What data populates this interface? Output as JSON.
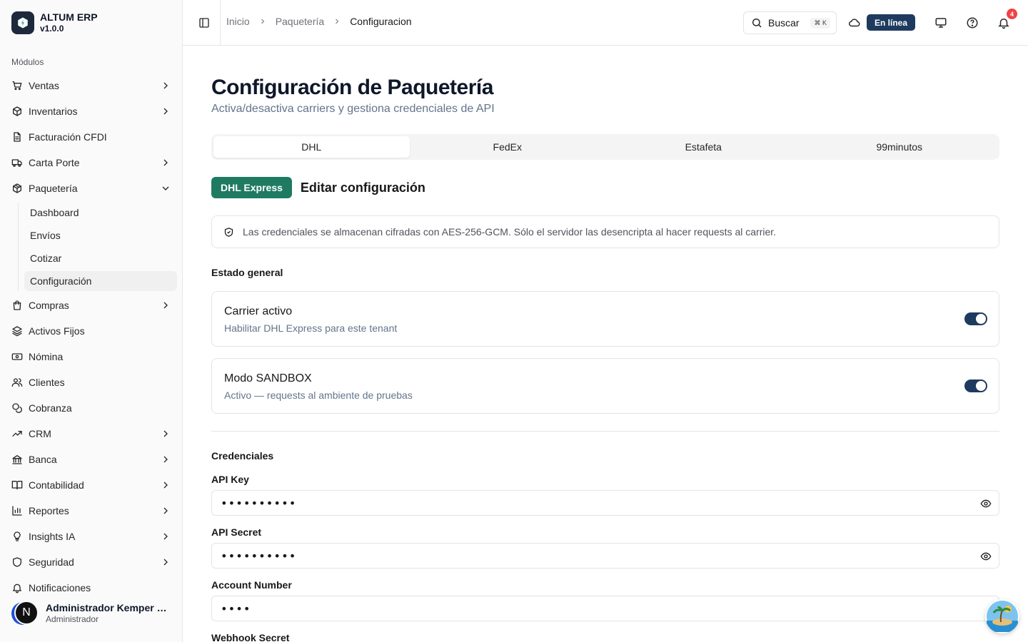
{
  "app": {
    "name": "ALTUM ERP",
    "version": "v1.0.0",
    "modules_label": "Módulos"
  },
  "nav": {
    "items": [
      {
        "label": "Ventas",
        "icon": "cart-icon",
        "chevron": "right"
      },
      {
        "label": "Inventarios",
        "icon": "box-icon",
        "chevron": "right"
      },
      {
        "label": "Facturación CFDI",
        "icon": "file-icon",
        "chevron": ""
      },
      {
        "label": "Carta Porte",
        "icon": "truck-icon",
        "chevron": "right"
      },
      {
        "label": "Paquetería",
        "icon": "package-icon",
        "chevron": "down"
      }
    ],
    "sub_items": [
      "Dashboard",
      "Envíos",
      "Cotizar",
      "Configuración"
    ],
    "items_after": [
      {
        "label": "Compras",
        "icon": "bag-icon",
        "chevron": "right"
      },
      {
        "label": "Activos Fijos",
        "icon": "layers-icon",
        "chevron": ""
      },
      {
        "label": "Nómina",
        "icon": "banknote-icon",
        "chevron": ""
      },
      {
        "label": "Clientes",
        "icon": "users-icon",
        "chevron": ""
      },
      {
        "label": "Cobranza",
        "icon": "coins-icon",
        "chevron": ""
      },
      {
        "label": "CRM",
        "icon": "trending-icon",
        "chevron": "right"
      },
      {
        "label": "Banca",
        "icon": "bank-icon",
        "chevron": "right"
      },
      {
        "label": "Contabilidad",
        "icon": "book-icon",
        "chevron": "right"
      },
      {
        "label": "Reportes",
        "icon": "chart-icon",
        "chevron": "right"
      },
      {
        "label": "Insights IA",
        "icon": "lightbulb-icon",
        "chevron": "right"
      },
      {
        "label": "Seguridad",
        "icon": "shield-icon",
        "chevron": "right"
      },
      {
        "label": "Notificaciones",
        "icon": "bell-icon",
        "chevron": ""
      }
    ]
  },
  "user": {
    "name": "Administrador Kemper U...",
    "role": "Administrador",
    "initial": "N"
  },
  "header": {
    "breadcrumb": [
      "Inicio",
      "Paquetería",
      "Configuracion"
    ],
    "search_label": "Buscar",
    "search_shortcut": "⌘ K",
    "status": "En línea",
    "notifications_count": "4"
  },
  "page": {
    "title": "Configuración de Paquetería",
    "subtitle": "Activa/desactiva carriers y gestiona credenciales de API",
    "tabs": [
      "DHL",
      "FedEx",
      "Estafeta",
      "99minutos"
    ],
    "active_tab": 0,
    "carrier_badge": "DHL Express",
    "edit_title": "Editar configuración",
    "notice": "Las credenciales se almacenan cifradas con AES-256-GCM. Sólo el servidor las desencripta al hacer requests al carrier.",
    "general_section": "Estado general",
    "toggles": [
      {
        "title": "Carrier activo",
        "desc": "Habilitar DHL Express para este tenant",
        "on": true
      },
      {
        "title": "Modo SANDBOX",
        "desc": "Activo — requests al ambiente de pruebas",
        "on": true
      }
    ],
    "credentials_section": "Credenciales",
    "fields": [
      {
        "label": "API Key",
        "value": "••••••••••"
      },
      {
        "label": "API Secret",
        "value": "••••••••••"
      },
      {
        "label": "Account Number",
        "value": "••••"
      },
      {
        "label": "Webhook Secret",
        "value": ""
      }
    ]
  },
  "colors": {
    "accent": "#1e3a5f",
    "carrier_badge": "#1f7a62",
    "notification": "#ef4444"
  }
}
